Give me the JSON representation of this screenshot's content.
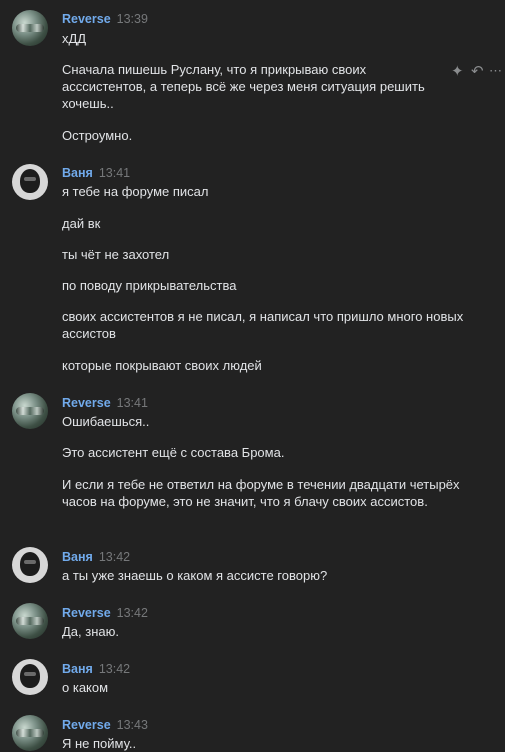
{
  "messages": [
    {
      "author": "Reverse",
      "time": "13:39",
      "lines": [
        "хДД",
        "Сначала пишешь Руслану, что я прикрываю своих асссистентов, а теперь всё же через меня ситуация решить хочешь..",
        "Остроумно."
      ]
    },
    {
      "author": "Ваня",
      "time": "13:41",
      "lines": [
        "я тебе на форуме писал",
        "дай вк",
        "ты чёт не захотел",
        "по поводу прикрывательства",
        "своих ассистентов я не писал, я написал что пришло много новых ассистов",
        "которые покрывают своих людей"
      ]
    },
    {
      "author": "Reverse",
      "time": "13:41",
      "lines": [
        "Ошибаешься..",
        "Это ассистент ещё с состава Брома.",
        "И если я тебе не ответил на форуме в течении двадцати четырёх часов на форуме, это не значит, что я блачу своих ассистов."
      ]
    },
    {
      "author": "Ваня",
      "time": "13:42",
      "lines": [
        "а ты уже знаешь о каком я ассисте говорю?"
      ]
    },
    {
      "author": "Reverse",
      "time": "13:42",
      "lines": [
        "Да, знаю."
      ]
    },
    {
      "author": "Ваня",
      "time": "13:42",
      "lines": [
        "о каком"
      ]
    },
    {
      "author": "Reverse",
      "time": "13:43",
      "lines": [
        "Я не пойму.."
      ]
    }
  ],
  "message_actions": {
    "icons": [
      "sparkle-icon",
      "reply-icon",
      "more-icon"
    ]
  }
}
